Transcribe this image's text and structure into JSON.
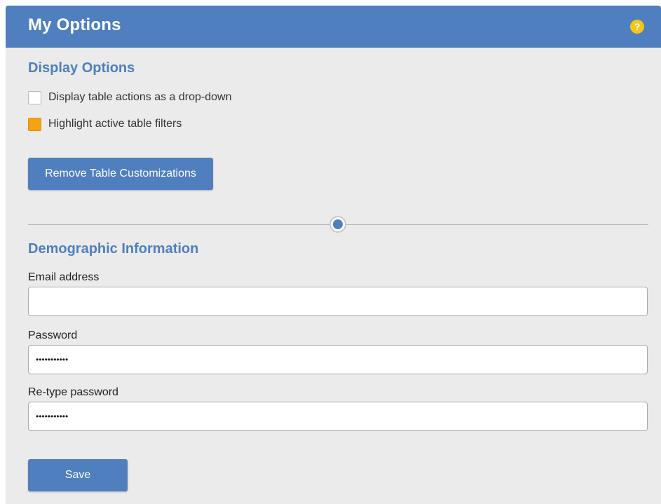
{
  "header": {
    "title": "My Options",
    "help_icon": "?"
  },
  "display_options": {
    "title": "Display Options",
    "checkboxes": [
      {
        "label": "Display table actions as a drop-down",
        "checked": false
      },
      {
        "label": "Highlight active table filters",
        "checked": true
      }
    ],
    "remove_button_label": "Remove Table Customizations"
  },
  "demographic": {
    "title": "Demographic Information",
    "email": {
      "label": "Email address",
      "value": ""
    },
    "password": {
      "label": "Password",
      "value": "•••••••••••"
    },
    "retype_password": {
      "label": "Re-type password",
      "value": "•••••••••••"
    }
  },
  "save_label": "Save",
  "colors": {
    "accent": "#4f7fbf",
    "panel_background": "#ebebeb",
    "checkbox_checked": "#f5a314",
    "help_icon": "#f5c518"
  }
}
